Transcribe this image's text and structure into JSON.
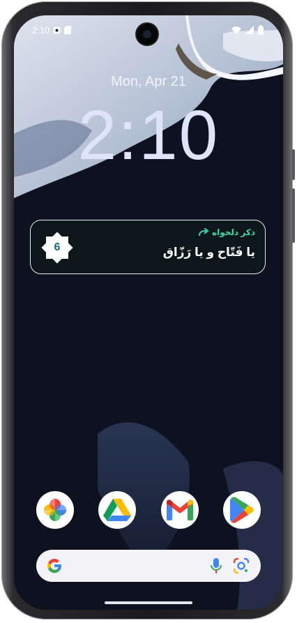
{
  "status_bar": {
    "time": "2:10",
    "left_icons": [
      "settings-notification-icon",
      "sd-card-icon"
    ],
    "right_icons": [
      "wifi-icon",
      "cellular-signal-icon",
      "battery-icon"
    ]
  },
  "lock_screen": {
    "date": "Mon, Apr 21",
    "clock": "2:10"
  },
  "widget": {
    "badge_number": "6",
    "subtitle": "ذکر دلخواه",
    "zikr_text": "یا فَتّاح و یا رَزّاق",
    "colors": {
      "accent": "#3dd9a6",
      "badge_text": "#0b6e7a",
      "border": "#e6ece8"
    }
  },
  "dock": {
    "apps": [
      {
        "name": "Google Photos",
        "icon": "google-photos-icon"
      },
      {
        "name": "Google Drive",
        "icon": "google-drive-icon"
      },
      {
        "name": "Gmail",
        "icon": "gmail-icon"
      },
      {
        "name": "Google Play Store",
        "icon": "play-store-icon"
      }
    ]
  },
  "search_bar": {
    "icons": [
      "google-g-icon",
      "microphone-icon",
      "google-lens-icon"
    ]
  }
}
